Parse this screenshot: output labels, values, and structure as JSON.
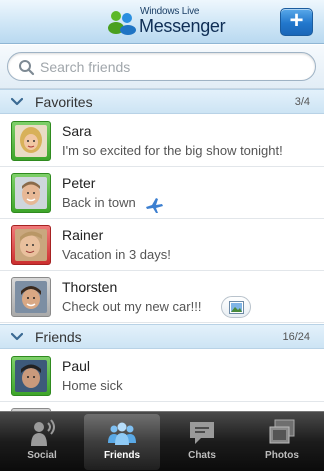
{
  "header": {
    "logo_line1": "Windows Live",
    "logo_line2": "Messenger",
    "add_label": "+"
  },
  "search": {
    "placeholder": "Search friends",
    "value": ""
  },
  "favorites": {
    "title": "Favorites",
    "count": "3/4",
    "contacts": [
      {
        "name": "Sara",
        "status": "I'm so excited for the big show tonight!",
        "presence": "online"
      },
      {
        "name": "Peter",
        "status": "Back in town",
        "presence": "online"
      },
      {
        "name": "Rainer",
        "status": "Vacation in 3 days!",
        "presence": "busy"
      },
      {
        "name": "Thorsten",
        "status": "Check out my new car!!!",
        "presence": "offline"
      }
    ]
  },
  "friends": {
    "title": "Friends",
    "count": "16/24",
    "contacts": [
      {
        "name": "Paul",
        "status": "Home sick",
        "presence": "online"
      }
    ]
  },
  "tabs": [
    {
      "label": "Social",
      "icon": "social-icon",
      "selected": false
    },
    {
      "label": "Friends",
      "icon": "friends-icon",
      "selected": true
    },
    {
      "label": "Chats",
      "icon": "chat-bubble-icon",
      "selected": false
    },
    {
      "label": "Photos",
      "icon": "photos-icon",
      "selected": false
    }
  ],
  "colors": {
    "accent": "#2277cc",
    "online": "#3ea52a",
    "busy": "#cc2f2f",
    "offline": "#a9a9a9",
    "tabbar": "#1c1c1c"
  }
}
